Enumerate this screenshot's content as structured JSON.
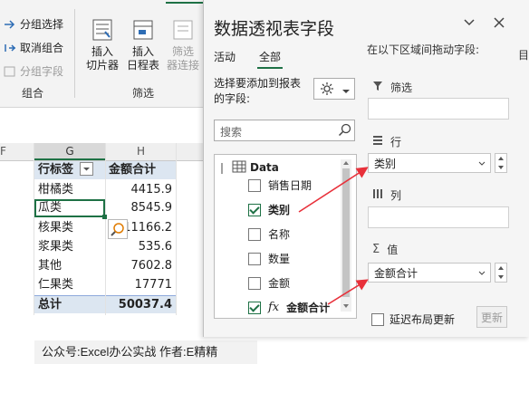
{
  "ribbon": {
    "small_buttons": [
      "分组选择",
      "取消组合",
      "分组字段"
    ],
    "group_label_1": "组合",
    "insert_slicer": [
      "插入",
      "切片器"
    ],
    "insert_timeline": [
      "插入",
      "日程表"
    ],
    "filter_connections": [
      "筛选",
      "器连接"
    ],
    "group_label_2": "筛选"
  },
  "sheet": {
    "col_f": "F",
    "col_g": "G",
    "col_h": "H",
    "header_row": {
      "label": "行标签",
      "sum": "金额合计"
    },
    "rows": [
      {
        "label": "柑橘类",
        "value": "4415.9"
      },
      {
        "label": "瓜类",
        "value": "8545.9"
      },
      {
        "label": "核果类",
        "value": "11166.2"
      },
      {
        "label": "浆果类",
        "value": "535.6"
      },
      {
        "label": "其他",
        "value": "7602.8"
      },
      {
        "label": "仁果类",
        "value": "17771"
      }
    ],
    "total": {
      "label": "总计",
      "value": "50037.4"
    },
    "footer_note": "公众号:Excel办公实战 作者:E精精"
  },
  "pane": {
    "title": "数据透视表字段",
    "tabs": {
      "active": "活动",
      "all": "全部"
    },
    "choose_label": "选择要添加到报表的字段:",
    "search_placeholder": "搜索",
    "drag_label": "在以下区域间拖动字段:",
    "table_name": "Data",
    "fields": [
      {
        "label": "销售日期",
        "checked": false
      },
      {
        "label": "类别",
        "checked": true
      },
      {
        "label": "名称",
        "checked": false
      },
      {
        "label": "数量",
        "checked": false
      },
      {
        "label": "金额",
        "checked": false
      },
      {
        "label": "金额合计",
        "checked": true
      }
    ],
    "areas": {
      "filter": "筛选",
      "rows": "行",
      "columns": "列",
      "values": "值"
    },
    "row_field": "类别",
    "value_field": "金额合计",
    "defer_label": "延迟布局更新",
    "update_button": "更新",
    "right_edge_text": "目"
  },
  "colors": {
    "accent": "#1e7145",
    "pivot_header": "#dce6f1",
    "arrow": "#e8303a"
  }
}
